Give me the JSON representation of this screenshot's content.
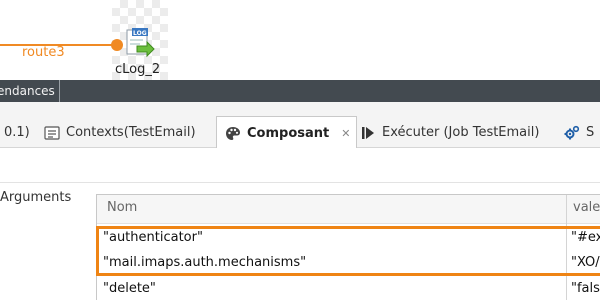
{
  "canvas": {
    "route_label": "route3",
    "component_label": "cLog_2",
    "component_icon": "log-icon",
    "colors": {
      "route": "#f08a24"
    }
  },
  "dark_strip": {
    "tab_label": "endances"
  },
  "tabs": [
    {
      "label": "0.1)",
      "icon": "none"
    },
    {
      "label": "Contexts(TestEmail)",
      "icon": "contexts-icon"
    },
    {
      "label": "Composant",
      "icon": "palette-icon",
      "active": true
    },
    {
      "label": "Exécuter (Job TestEmail)",
      "icon": "run-icon"
    },
    {
      "label": "S",
      "icon": "gears-icon"
    }
  ],
  "content": {
    "arguments_label": "Arguments",
    "table": {
      "columns": [
        "Nom",
        "vale"
      ],
      "rows": [
        {
          "name": "\"authenticator\"",
          "value": "\"#ex"
        },
        {
          "name": "\"mail.imaps.auth.mechanisms\"",
          "value": "\"XO/"
        },
        {
          "name": "\"delete\"",
          "value": "\"fals"
        }
      ]
    },
    "highlight_color": "#ef8414"
  }
}
